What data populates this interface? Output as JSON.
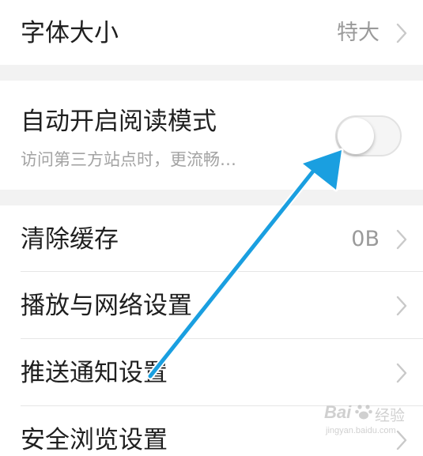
{
  "settings": {
    "font_size": {
      "label": "字体大小",
      "value": "特大",
      "icon": "chevron-right-icon"
    },
    "auto_reader": {
      "label": "自动开启阅读模式",
      "subtitle": "访问第三方站点时，更流畅…",
      "enabled": false
    },
    "clear_cache": {
      "label": "清除缓存",
      "value": "0B",
      "icon": "chevron-right-icon"
    },
    "playback_network": {
      "label": "播放与网络设置",
      "icon": "chevron-right-icon"
    },
    "push_notifications": {
      "label": "推送通知设置",
      "icon": "chevron-right-icon"
    },
    "safe_browsing": {
      "label": "安全浏览设置",
      "icon": "chevron-right-icon"
    }
  },
  "annotation": {
    "icon": "arrow-icon",
    "color": "#1a9fe0"
  },
  "watermark": {
    "brand": "Bai",
    "brand_suffix": "经验",
    "url": "jingyan.baidu.com",
    "icon": "paw-icon"
  },
  "colors": {
    "section_gap": "#f2f2f2",
    "divider": "#e6e6e6",
    "secondary_text": "#9a9a9a"
  }
}
